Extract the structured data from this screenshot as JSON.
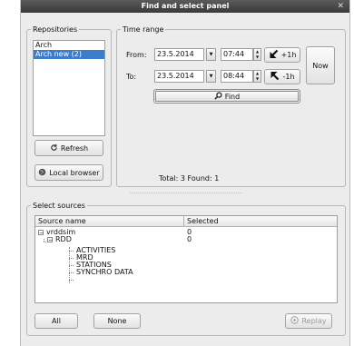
{
  "window": {
    "title": "Find and select panel",
    "close_glyph": "✕"
  },
  "repositories": {
    "legend": "Repositories",
    "items": [
      {
        "label": "Arch",
        "selected": false
      },
      {
        "label": "Arch new (2)",
        "selected": true
      }
    ],
    "refresh_label": "Refresh",
    "local_browser_label": "Local browser"
  },
  "time_range": {
    "legend": "Time range",
    "from_label": "From:",
    "from_date": "23.5.2014",
    "from_time": "07:44",
    "from_step_label": "+1h",
    "to_label": "To:",
    "to_date": "23.5.2014",
    "to_time": "08:44",
    "to_step_label": "-1h",
    "now_label": "Now",
    "find_label": "Find",
    "total_text": "Total: 3 Found: 1"
  },
  "sources": {
    "legend": "Select sources",
    "columns": [
      "Source name",
      "Selected"
    ],
    "rows": [
      {
        "name": "vrddsim",
        "selected": "0"
      },
      {
        "name": "RDD",
        "selected": "0"
      },
      {
        "name": "ACTIVITIES",
        "selected": ""
      },
      {
        "name": "MRD",
        "selected": ""
      },
      {
        "name": "STATIONS",
        "selected": ""
      },
      {
        "name": "SYNCHRO DATA",
        "selected": ""
      }
    ],
    "all_label": "All",
    "none_label": "None",
    "replay_label": "Replay"
  },
  "colors": {
    "selection": "#3d7cc9",
    "titlebar": "#3a3a3a",
    "panel": "#ececec"
  },
  "icons": [
    "refresh-icon",
    "globe-icon",
    "search-icon",
    "arrow-down-left-icon",
    "arrow-up-left-icon",
    "play-icon"
  ]
}
